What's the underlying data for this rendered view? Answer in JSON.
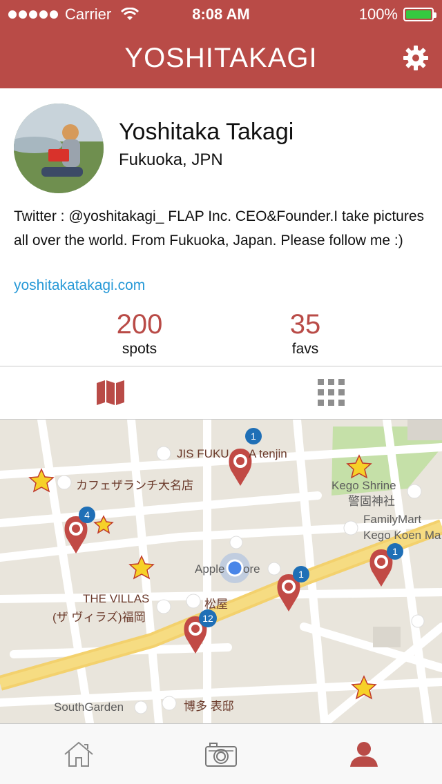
{
  "status_bar": {
    "carrier": "Carrier",
    "time": "8:08 AM",
    "battery": "100%"
  },
  "nav": {
    "title": "YOSHITAKAGI"
  },
  "profile": {
    "name": "Yoshitaka Takagi",
    "location": "Fukuoka, JPN",
    "bio": "Twitter : @yoshitakagi_ FLAP Inc. CEO&Founder.I take pictures all over the world. From Fukuoka, Japan. Please follow me :)",
    "link": "yoshitakatakagi.com"
  },
  "stats": {
    "spots_value": "200",
    "spots_label": "spots",
    "favs_value": "35",
    "favs_label": "favs"
  },
  "map": {
    "labels": {
      "jis": "JIS FUKU",
      "tenjin": "A tenjin",
      "cafe": "カフェザランチ大名店",
      "kego_shrine": "Kego Shrine",
      "kego_shrine_jp": "警固神社",
      "familymart": "FamilyMart",
      "kego_koen": "Kego Koen Ma",
      "apple_a": "Apple",
      "apple_b": "ore",
      "villas_a": "THE VILLAS",
      "villas_b": "(ザ ヴィラズ)福岡",
      "matsuya": "松屋",
      "southgarden": "SouthGarden",
      "hakata": "博多 表邸"
    },
    "pin_counts": [
      "1",
      "4",
      "1",
      "1",
      "12"
    ]
  },
  "tabs": {
    "home": "home-icon",
    "camera": "camera-icon",
    "profile": "profile-icon"
  },
  "colors": {
    "brand": "#b94b47",
    "link": "#2799d7"
  }
}
